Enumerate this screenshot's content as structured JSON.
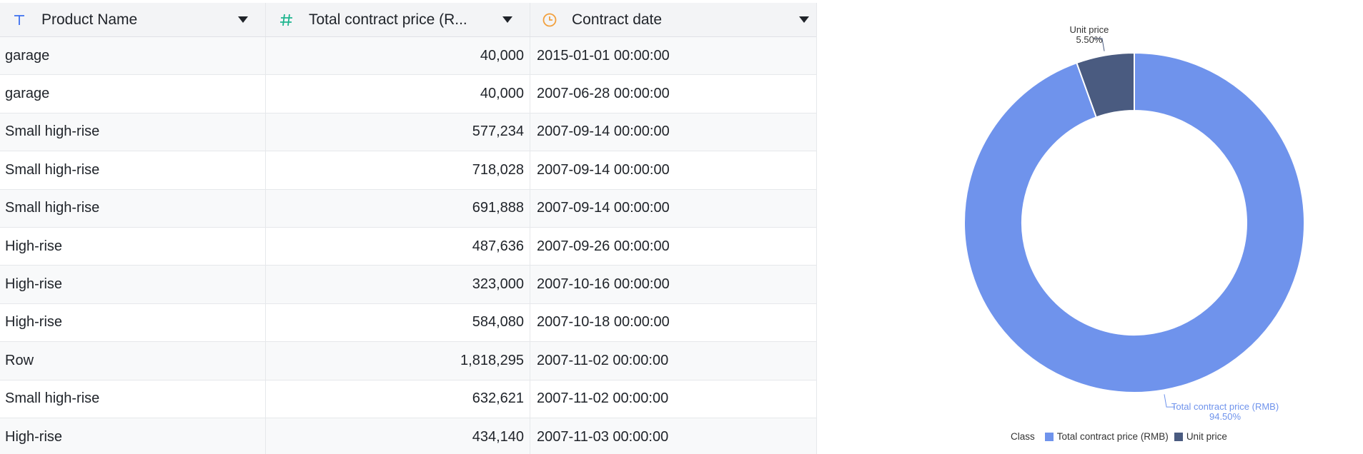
{
  "table": {
    "columns": [
      {
        "label": "Product Name",
        "type_icon": "text-type-icon",
        "icon_color": "#3c6ff0"
      },
      {
        "label": "Total contract price (RMB)",
        "display_label": "Total contract price (R...",
        "type_icon": "number-type-icon",
        "icon_color": "#1fb58f"
      },
      {
        "label": "Contract date",
        "type_icon": "date-type-icon",
        "icon_color": "#f2a03d"
      }
    ],
    "rows": [
      {
        "product": "garage",
        "price": "40,000",
        "date": "2015-01-01 00:00:00"
      },
      {
        "product": "garage",
        "price": "40,000",
        "date": "2007-06-28 00:00:00"
      },
      {
        "product": "Small high-rise",
        "price": "577,234",
        "date": "2007-09-14 00:00:00"
      },
      {
        "product": "Small high-rise",
        "price": "718,028",
        "date": "2007-09-14 00:00:00"
      },
      {
        "product": "Small high-rise",
        "price": "691,888",
        "date": "2007-09-14 00:00:00"
      },
      {
        "product": "High-rise",
        "price": "487,636",
        "date": "2007-09-26 00:00:00"
      },
      {
        "product": "High-rise",
        "price": "323,000",
        "date": "2007-10-16 00:00:00"
      },
      {
        "product": "High-rise",
        "price": "584,080",
        "date": "2007-10-18 00:00:00"
      },
      {
        "product": "Row",
        "price": "1,818,295",
        "date": "2007-11-02 00:00:00"
      },
      {
        "product": "Small high-rise",
        "price": "632,621",
        "date": "2007-11-02 00:00:00"
      },
      {
        "product": "High-rise",
        "price": "434,140",
        "date": "2007-11-03 00:00:00"
      }
    ]
  },
  "chart_data": {
    "type": "pie",
    "style": "donut",
    "legend_title": "Class",
    "legend_position": "bottom",
    "slices": [
      {
        "name": "Total contract price (RMB)",
        "value": 94.5,
        "label": "94.50%",
        "color": "#6f93ec"
      },
      {
        "name": "Unit price",
        "value": 5.5,
        "label": "5.50%",
        "color": "#4a5b80"
      }
    ]
  }
}
